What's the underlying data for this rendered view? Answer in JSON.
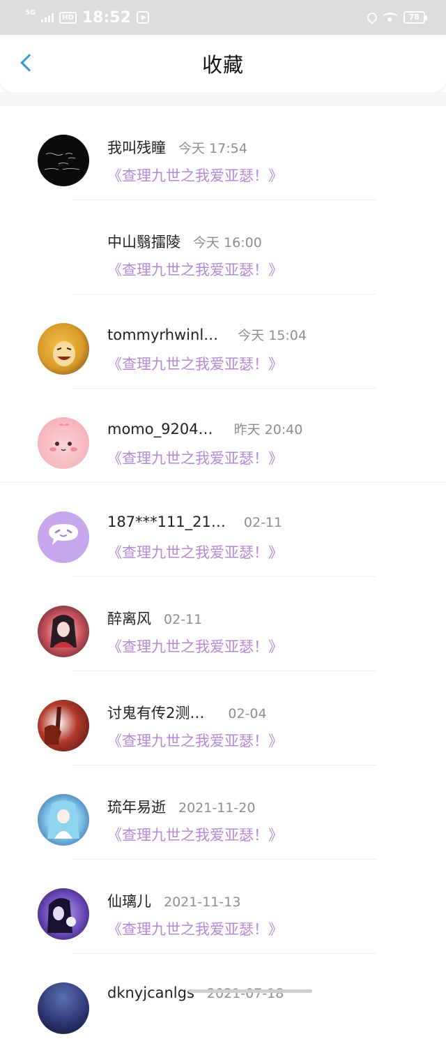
{
  "status_bar": {
    "network": "5G",
    "hd": "HD",
    "time": "18:52",
    "battery": "78"
  },
  "header": {
    "title": "收藏"
  },
  "items": [
    {
      "name": "我叫残瞳",
      "time": "今天 17:54",
      "book": "《查理九世之我爱亚瑟！》",
      "avatar": "dark-text-avatar"
    },
    {
      "name": "中山翳擂陵",
      "time": "今天 16:00",
      "book": "《查理九世之我爱亚瑟！》",
      "avatar": "none"
    },
    {
      "name": "tommyrhwinl…",
      "time": "今天 15:04",
      "book": "《查理九世之我爱亚瑟！》",
      "avatar": "anime-yellow-avatar"
    },
    {
      "name": "momo_9204…",
      "time": "昨天 20:40",
      "book": "《查理九世之我爱亚瑟！》",
      "avatar": "pink-avatar"
    },
    {
      "name": "187***111_21…",
      "time": "02-11",
      "book": "《查理九世之我爱亚瑟！》",
      "avatar": "chat-bubble-avatar"
    },
    {
      "name": "醉离风",
      "time": "02-11",
      "book": "《查理九世之我爱亚瑟！》",
      "avatar": "red-girl-avatar"
    },
    {
      "name": "讨鬼有传2测…",
      "time": "02-04",
      "book": "《查理九世之我爱亚瑟！》",
      "avatar": "red-dark-avatar"
    },
    {
      "name": "琉年易逝",
      "time": "2021-11-20",
      "book": "《查理九世之我爱亚瑟！》",
      "avatar": "blue-anime-avatar"
    },
    {
      "name": "仙璃儿",
      "time": "2021-11-13",
      "book": "《查理九世之我爱亚瑟！》",
      "avatar": "violet-avatar"
    },
    {
      "name": "dknyjcanlgs",
      "time": "2021-07-18",
      "book": "",
      "avatar": "night-avatar"
    }
  ],
  "colors": {
    "accent": "#2f9bd6",
    "book_title": "#b48ad6",
    "time_text": "#8e8e8e"
  }
}
